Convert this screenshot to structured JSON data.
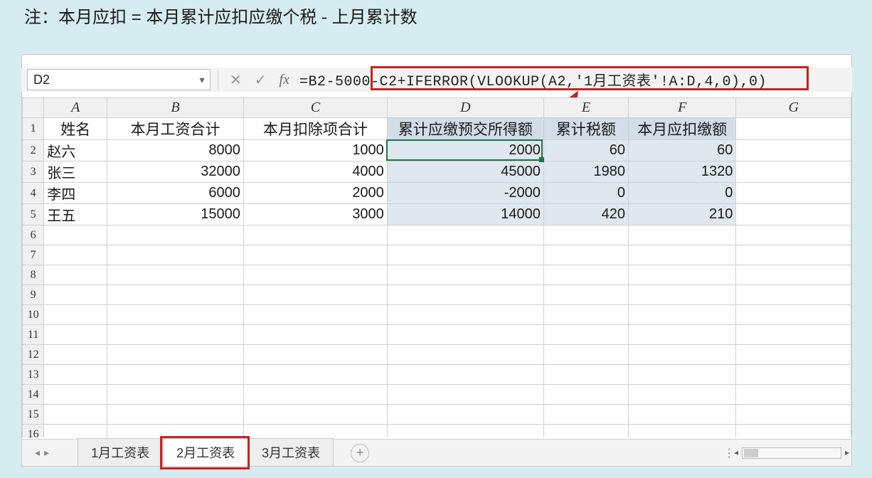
{
  "note": "注：本月应扣 = 本月累计应扣应缴个税 - 上月累计数",
  "namebox": {
    "ref": "D2"
  },
  "formula": "=B2-5000-C2+IFERROR(VLOOKUP(A2,'1月工资表'!A:D,4,0),0)",
  "columns": [
    "A",
    "B",
    "C",
    "D",
    "E",
    "F",
    "G"
  ],
  "row_numbers": [
    1,
    2,
    3,
    4,
    5,
    6,
    7,
    8,
    9,
    10,
    11,
    12,
    13,
    14,
    15,
    16
  ],
  "headers": {
    "A": "姓名",
    "B": "本月工资合计",
    "C": "本月扣除项合计",
    "D": "累计应缴预交所得额",
    "E": "累计税额",
    "F": "本月应扣缴额"
  },
  "shaded_cols": [
    "D",
    "E",
    "F"
  ],
  "rows": [
    {
      "A": "赵六",
      "B": "8000",
      "C": "1000",
      "D": "2000",
      "E": "60",
      "F": "60"
    },
    {
      "A": "张三",
      "B": "32000",
      "C": "4000",
      "D": "45000",
      "E": "1980",
      "F": "1320"
    },
    {
      "A": "李四",
      "B": "6000",
      "C": "2000",
      "D": "-2000",
      "E": "0",
      "F": "0"
    },
    {
      "A": "王五",
      "B": "15000",
      "C": "3000",
      "D": "14000",
      "E": "420",
      "F": "210"
    }
  ],
  "selected_cell": "D2",
  "tabs": {
    "items": [
      "1月工资表",
      "2月工资表",
      "3月工资表"
    ],
    "active_index": 1
  },
  "colors": {
    "highlight_border": "#cc1f1f",
    "selection": "#1f7246"
  }
}
